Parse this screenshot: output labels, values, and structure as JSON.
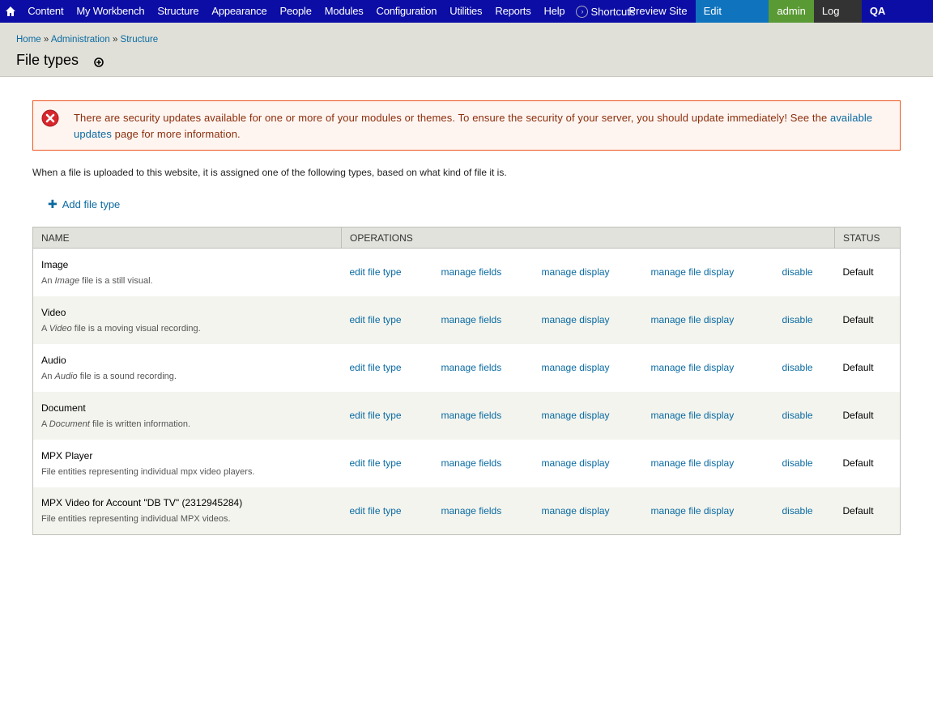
{
  "toolbar": {
    "menu": [
      "Content",
      "My Workbench",
      "Structure",
      "Appearance",
      "People",
      "Modules",
      "Configuration",
      "Utilities",
      "Reports",
      "Help"
    ],
    "shortcuts_label": "Shortcuts",
    "preview_label": "Preview Site",
    "edit_shortcuts_label": "Edit shortcuts",
    "user_label": "admin",
    "logout_label": "Log out",
    "server_label": "QA SERVER"
  },
  "breadcrumb": [
    "Home",
    "Administration",
    "Structure"
  ],
  "breadcrumb_separator": "»",
  "page": {
    "title": "File types"
  },
  "message": {
    "text_before": "There are security updates available for one or more of your modules or themes. To ensure the security of your server, you should update immediately! See the ",
    "link": "available updates",
    "text_after": " page for more information."
  },
  "intro": "When a file is uploaded to this website, it is assigned one of the following types, based on what kind of file it is.",
  "add_link": "Add file type",
  "table": {
    "headers": [
      "NAME",
      "OPERATIONS",
      "STATUS"
    ],
    "operations": [
      "edit file type",
      "manage fields",
      "manage display",
      "manage file display",
      "disable"
    ],
    "rows": [
      {
        "name": "Image",
        "desc_pre": "An ",
        "desc_em": "Image",
        "desc_post": " file is a still visual.",
        "status": "Default"
      },
      {
        "name": "Video",
        "desc_pre": "A ",
        "desc_em": "Video",
        "desc_post": " file is a moving visual recording.",
        "status": "Default"
      },
      {
        "name": "Audio",
        "desc_pre": "An ",
        "desc_em": "Audio",
        "desc_post": " file is a sound recording.",
        "status": "Default"
      },
      {
        "name": "Document",
        "desc_pre": "A ",
        "desc_em": "Document",
        "desc_post": " file is written information.",
        "status": "Default"
      },
      {
        "name": "MPX Player",
        "desc_pre": "File entities representing individual mpx video players.",
        "desc_em": "",
        "desc_post": "",
        "status": "Default"
      },
      {
        "name": "MPX Video for Account \"DB TV\" (2312945284)",
        "desc_pre": "File entities representing individual MPX videos.",
        "desc_em": "",
        "desc_post": "",
        "status": "Default"
      }
    ]
  },
  "colors": {
    "toolbar_bg": "#0b0da5",
    "link": "#0a6aa1",
    "error_border": "#ed541d",
    "error_text": "#8c2e0b"
  }
}
